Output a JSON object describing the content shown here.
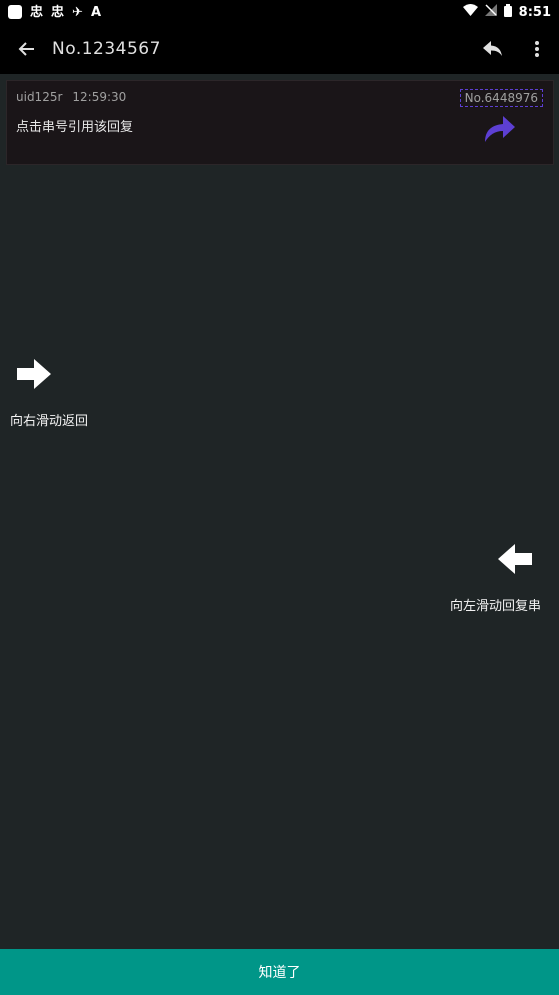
{
  "status_bar": {
    "time": "8:51",
    "glyphs": [
      "忠",
      "忠",
      "✈",
      "A"
    ]
  },
  "appbar": {
    "title": "No.1234567",
    "back_icon": "arrow-left-icon",
    "reply_icon": "reply-icon",
    "more_icon": "more-vert-icon"
  },
  "card": {
    "uid": "uid125r",
    "time": "12:59:30",
    "serial": "No.6448976",
    "hint": "点击串号引用该回复"
  },
  "gestures": {
    "swipe_right_label": "向右滑动返回",
    "swipe_left_label": "向左滑动回复串"
  },
  "ok_button": {
    "label": "知道了"
  },
  "colors": {
    "background": "#1f2526",
    "appbar": "#000000",
    "card": "#1a1518",
    "accent_purple": "#5d3fd3",
    "button": "#009688"
  }
}
